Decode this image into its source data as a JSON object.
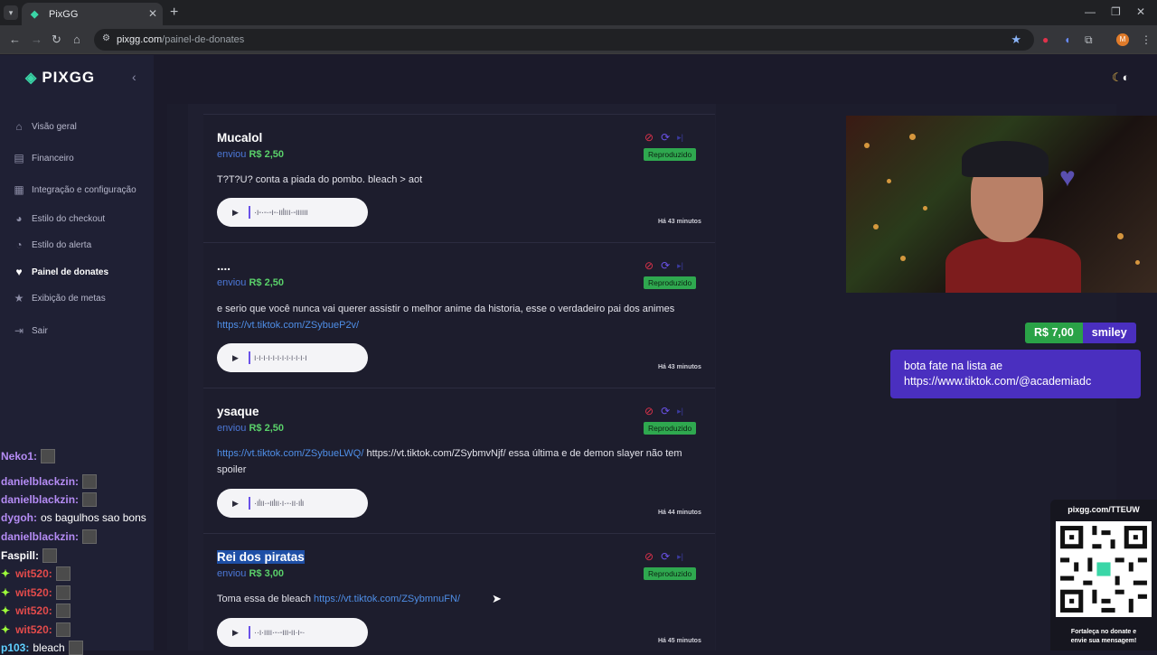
{
  "browser": {
    "tab_title": "PixGG",
    "url_host": "pixgg.com",
    "url_path": "/painel-de-donates",
    "profile_initial": "M"
  },
  "sidebar": {
    "brand": "PIXGG",
    "items": [
      {
        "label": "Visão geral",
        "icon": "home-icon",
        "active": false
      },
      {
        "label": "Financeiro",
        "icon": "wallet-icon",
        "active": false
      },
      {
        "label": "Integração e configuração",
        "icon": "settings-icon",
        "active": false
      },
      {
        "label": "Estilo do checkout",
        "icon": "palette-icon",
        "active": false
      },
      {
        "label": "Estilo do alerta",
        "icon": "palette-icon",
        "active": false
      },
      {
        "label": "Painel de donates",
        "icon": "donate-icon",
        "active": true
      },
      {
        "label": "Exibição de metas",
        "icon": "star-icon",
        "active": false
      },
      {
        "label": "Sair",
        "icon": "logout-icon",
        "active": false
      }
    ]
  },
  "donations": [
    {
      "name": "Mucalol",
      "sent_label": "enviou",
      "amount": "R$ 2,50",
      "status": "Reproduzido",
      "message": [
        {
          "text": "T?T?U? conta a piada do pombo. bleach > aot",
          "link": false
        }
      ],
      "waveform": "·ı-·-·-ı-·ıılııı·-ıııııı",
      "time": "Há 43 minutos"
    },
    {
      "name": "....",
      "sent_label": "enviou",
      "amount": "R$ 2,50",
      "status": "Reproduzido",
      "message": [
        {
          "text": "e serio que você nunca vai querer assistir o melhor anime da historia, esse o verdadeiro pai dos animes",
          "link": false
        },
        {
          "text": "https://vt.tiktok.com/ZSybueP2v/",
          "link": true
        }
      ],
      "waveform": "ı·ı·ı·ı·ı·ı·ı·ı·ı·ı·ı·ı",
      "time": "Há 43 minutos"
    },
    {
      "name": "ysaque",
      "sent_label": "enviou",
      "amount": "R$ 2,50",
      "status": "Reproduzido",
      "message": [
        {
          "text": "https://vt.tiktok.com/ZSybueLWQ/",
          "link": true
        },
        {
          "text": " https://vt.tiktok.com/ZSybmvNjf/ essa última e de demon slayer não tem spoiler",
          "link": false
        }
      ],
      "waveform": "·ılıı·-ıılıı·ı·-·ıı·ılı",
      "time": "Há 44 minutos"
    },
    {
      "name": "Rei dos piratas",
      "sent_label": "enviou",
      "amount": "R$ 3,00",
      "status": "Reproduzido",
      "message": [
        {
          "text": "Toma essa de bleach ",
          "link": false
        },
        {
          "text": "https://vt.tiktok.com/ZSybmnuFN/",
          "link": true
        }
      ],
      "waveform": "··ı·ıııı·-·-ııı-ıı·ı-·",
      "time": "Há 45 minutos"
    }
  ],
  "alert": {
    "amount": "R$ 7,00",
    "donor": "smiley",
    "message_line1": "bota fate na lista ae",
    "message_line2": "https://www.tiktok.com/@academiadc"
  },
  "qr_widget": {
    "url": "pixgg.com/TTEUW",
    "cta_line1": "Fortaleça no donate e",
    "cta_line2": "envie sua mensagem!"
  },
  "chat": [
    {
      "user": "Neko1:",
      "text": "",
      "color": "#b58cf5",
      "emote": true,
      "partial": true
    },
    {
      "user": "danielblackzin:",
      "text": "",
      "color": "#b58cf5",
      "emote": true
    },
    {
      "user": "danielblackzin:",
      "text": "",
      "color": "#b58cf5",
      "emote": true
    },
    {
      "user": "dygoh:",
      "text": "os bagulhos sao bons",
      "color": "#b58cf5",
      "emote": false
    },
    {
      "user": "danielblackzin:",
      "text": "",
      "color": "#b58cf5",
      "emote": true
    },
    {
      "user": "Faspill:",
      "text": "",
      "color": "#ffffff",
      "emote": true
    },
    {
      "user": "wit520:",
      "text": "",
      "color": "#e34b4b",
      "emote": true,
      "spark": true
    },
    {
      "user": "wit520:",
      "text": "",
      "color": "#e34b4b",
      "emote": true,
      "spark": true
    },
    {
      "user": "wit520:",
      "text": "",
      "color": "#e34b4b",
      "emote": true,
      "spark": true
    },
    {
      "user": "wit520:",
      "text": "",
      "color": "#e34b4b",
      "emote": true,
      "spark": true
    },
    {
      "user": "p103:",
      "text": "bleach",
      "color": "#5fd0ff",
      "emote": true
    }
  ],
  "colors": {
    "accent": "#4a2fbf",
    "success": "#2fa84f",
    "link": "#4f8fe8",
    "danger": "#e0324b"
  }
}
